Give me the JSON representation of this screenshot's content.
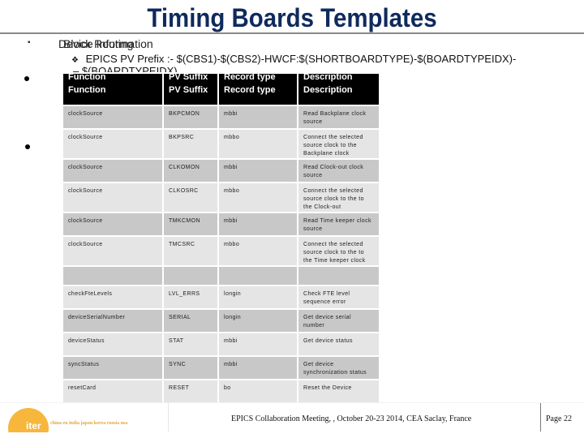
{
  "slide": {
    "title": "Timing Boards Templates",
    "bullet_overlap_text_a": "Device Information",
    "bullet_overlap_text_b": "Block Routing",
    "pv_prefix_line": "EPICS PV Prefix :- $(CBS1)-$(CBS2)-HWCF:$(SHORTBOARDTYPE)-$(BOARDTYPEIDX)-",
    "pv_prefix_continuation": "– $(BOARDTYPEIDX)"
  },
  "table": {
    "headers": [
      "Function",
      "PV Suffix",
      "Record type",
      "Description"
    ],
    "rows": [
      {
        "function": "clockSource",
        "pv_suffix": "BKPCMON",
        "record_type": "mbbi",
        "description": "Read Backplane clock source"
      },
      {
        "function": "clockSource",
        "pv_suffix": "BKPSRC",
        "record_type": "mbbo",
        "description": "Connect the selected source clock to the Backplane clock"
      },
      {
        "function": "clockSource",
        "pv_suffix": "CLKOMON",
        "record_type": "mbbi",
        "description": "Read Clock-out clock source"
      },
      {
        "function": "clockSource",
        "pv_suffix": "CLKOSRC",
        "record_type": "mbbo",
        "description": "Connect the selected source clock to the  to the  Clock-out"
      },
      {
        "function": "clockSource",
        "pv_suffix": "TMKCMON",
        "record_type": "mbbi",
        "description": "Read Time keeper clock source"
      },
      {
        "function": "clockSource",
        "pv_suffix": "TMCSRC",
        "record_type": "mbbo",
        "description": "Connect the selected source clock to the  to the  Time keeper clock"
      },
      {
        "function": "",
        "pv_suffix": "",
        "record_type": "",
        "description": ""
      },
      {
        "function": "checkFteLevels",
        "pv_suffix": "LVL_ERRS",
        "record_type": "longin",
        "description": "Check FTE level sequence error"
      },
      {
        "function": "deviceSerialNumber",
        "pv_suffix": "SERIAL",
        "record_type": "longin",
        "description": "Get device serial number"
      },
      {
        "function": "deviceStatus",
        "pv_suffix": "STAT",
        "record_type": "mbbi",
        "description": "Get device status"
      },
      {
        "function": "syncStatus",
        "pv_suffix": "SYNC",
        "record_type": "mbbi",
        "description": "Get device synchronization status"
      },
      {
        "function": "resetCard",
        "pv_suffix": "RESET",
        "record_type": "bo",
        "description": "Reset the Device"
      }
    ]
  },
  "footer": {
    "logo_text": "iter",
    "members": "china eu india japan korea russia usa",
    "meeting": "EPICS Collaboration Meeting, , October 20-23 2014, CEA Saclay, France",
    "page": "Page 22"
  },
  "colors": {
    "title": "#0f2a5c",
    "header_bg": "#000000",
    "row_dark": "#c8c8c8",
    "row_light": "#e5e5e5",
    "logo": "#f6b73c"
  }
}
